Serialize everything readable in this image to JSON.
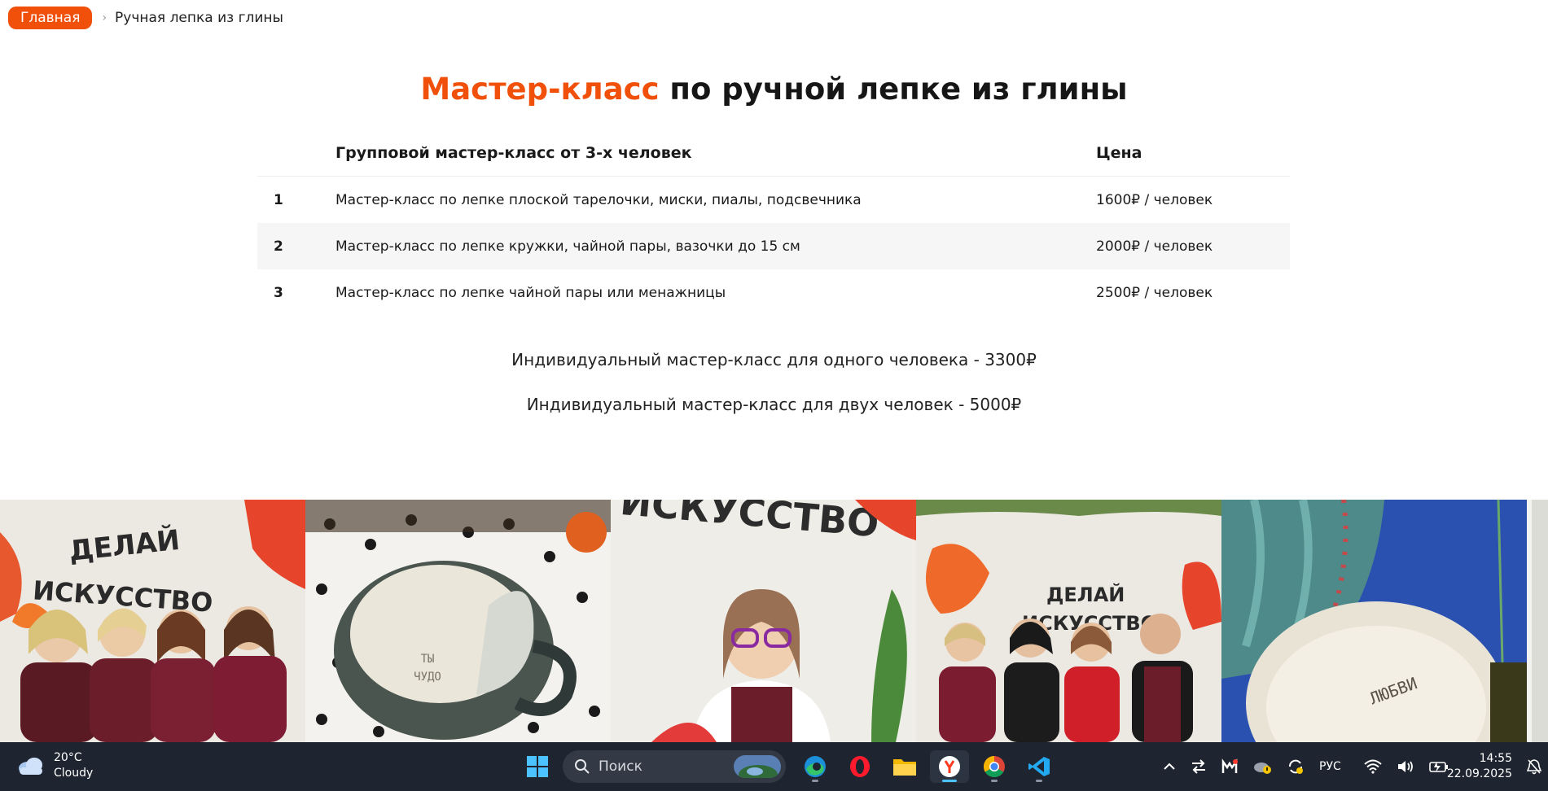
{
  "breadcrumb": {
    "home": "Главная",
    "separator": "›",
    "current": "Ручная лепка из глины"
  },
  "title": {
    "accent": "Мастер-класс",
    "rest": " по ручной лепке из глины"
  },
  "table": {
    "header": {
      "num": "",
      "desc": "Групповой мастер-класс от 3-х человек",
      "price": "Цена"
    },
    "rows": [
      {
        "num": "1",
        "desc": "Мастер-класс по лепке плоской тарелочки, миски, пиалы, подсвечника",
        "price": "1600₽ / человек"
      },
      {
        "num": "2",
        "desc": "Мастер-класс по лепке кружки, чайной пары, вазочки до 15 см",
        "price": "2000₽ / человек"
      },
      {
        "num": "3",
        "desc": "Мастер-класс по лепке чайной пары или менажницы",
        "price": "2500₽ / человек"
      }
    ]
  },
  "individual": {
    "one": "Индивидуальный мастер-класс для одного человека - 3300₽",
    "two": "Индивидуальный мастер-класс для двух человек - 5000₽"
  },
  "gallery": {
    "photo1_sign": [
      "ДЕЛАЙ",
      "ИСКУССТВО"
    ],
    "photo2_sign": [
      "ТЫ",
      "ЧУДО"
    ],
    "photo3_sign": [
      "ИСКУССТВО"
    ],
    "photo4_sign": [
      "ДЕЛАЙ",
      "ИСКУССТВО"
    ],
    "photo5_sign": [
      "ЛЮБВИ"
    ]
  },
  "taskbar": {
    "weather": {
      "temp": "20°C",
      "condition": "Cloudy"
    },
    "search_placeholder": "Поиск",
    "language": "РУС",
    "time": "14:55",
    "date": "22.09.2025"
  },
  "colors": {
    "accent": "#f0500a",
    "taskbar": "#1f2530"
  }
}
